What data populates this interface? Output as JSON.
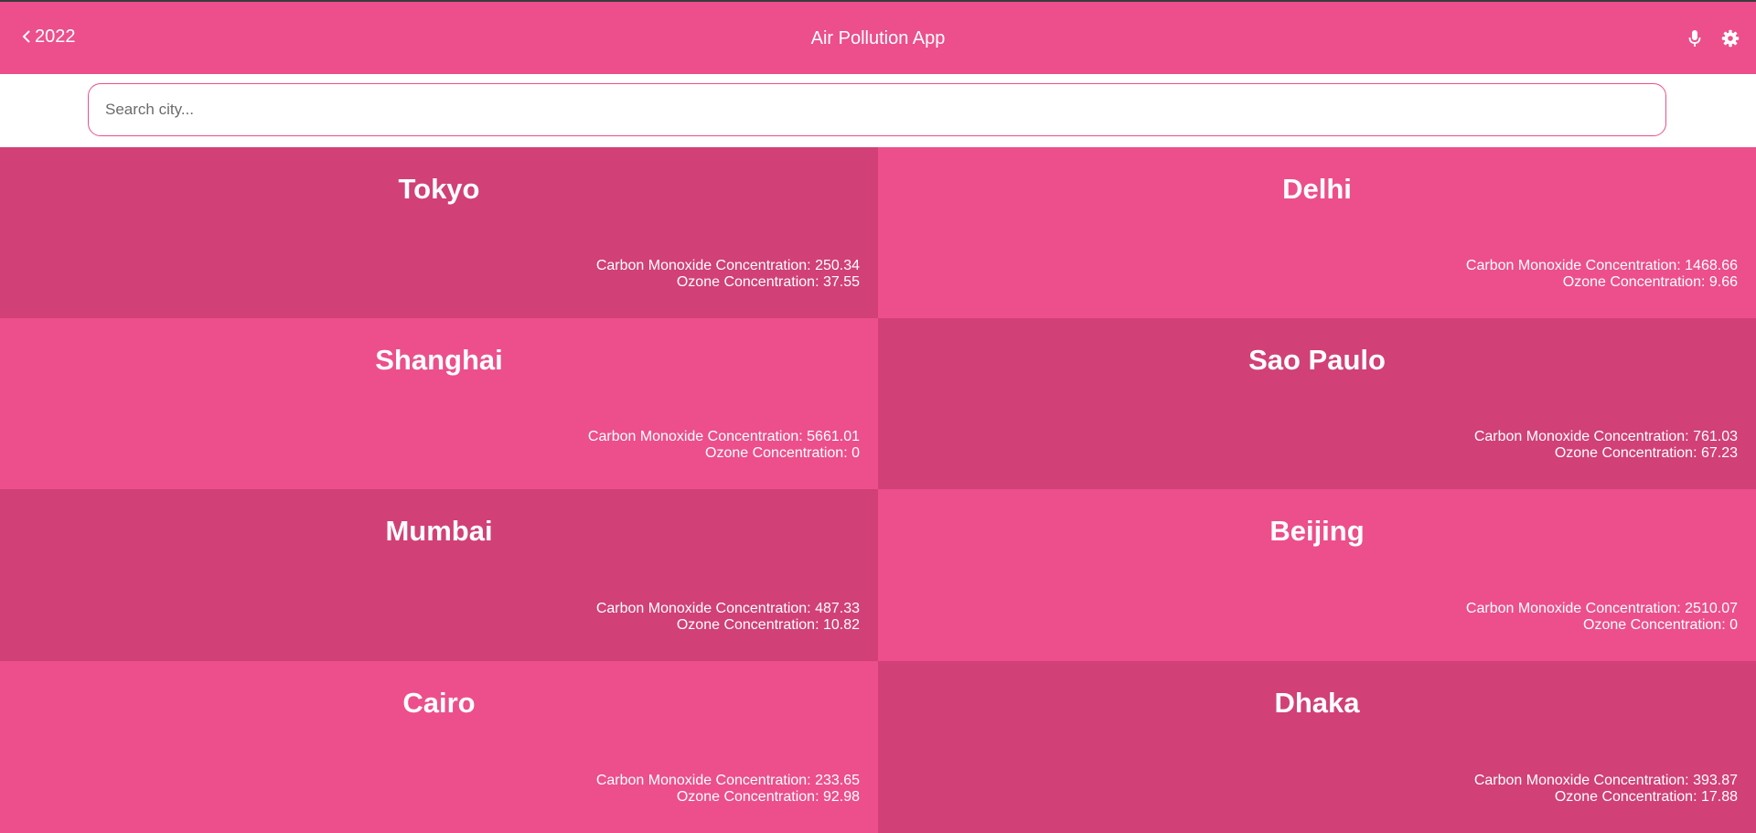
{
  "appbar": {
    "back_label": "2022",
    "title": "Air Pollution App",
    "icons": [
      "chevron-left-icon",
      "microphone-icon",
      "gear-icon"
    ],
    "background": "#ec4f8b"
  },
  "search": {
    "placeholder": "Search city...",
    "value": "",
    "border_color": "#ec4f8b"
  },
  "colors": {
    "card_dark": "#d14076",
    "card_light": "#ec4f8b",
    "text": "#ffffff"
  },
  "cities": [
    {
      "name": "Tokyo",
      "co": "Carbon Monoxide Concentration: 250.34",
      "ozone": "Ozone Concentration: 37.55"
    },
    {
      "name": "Delhi",
      "co": "Carbon Monoxide Concentration: 1468.66",
      "ozone": "Ozone Concentration: 9.66"
    },
    {
      "name": "Shanghai",
      "co": "Carbon Monoxide Concentration: 5661.01",
      "ozone": "Ozone Concentration: 0"
    },
    {
      "name": "Sao Paulo",
      "co": "Carbon Monoxide Concentration: 761.03",
      "ozone": "Ozone Concentration: 67.23"
    },
    {
      "name": "Mumbai",
      "co": "Carbon Monoxide Concentration: 487.33",
      "ozone": "Ozone Concentration: 10.82"
    },
    {
      "name": "Beijing",
      "co": "Carbon Monoxide Concentration: 2510.07",
      "ozone": "Ozone Concentration: 0"
    },
    {
      "name": "Cairo",
      "co": "Carbon Monoxide Concentration: 233.65",
      "ozone": "Ozone Concentration: 92.98"
    },
    {
      "name": "Dhaka",
      "co": "Carbon Monoxide Concentration: 393.87",
      "ozone": "Ozone Concentration: 17.88"
    }
  ]
}
